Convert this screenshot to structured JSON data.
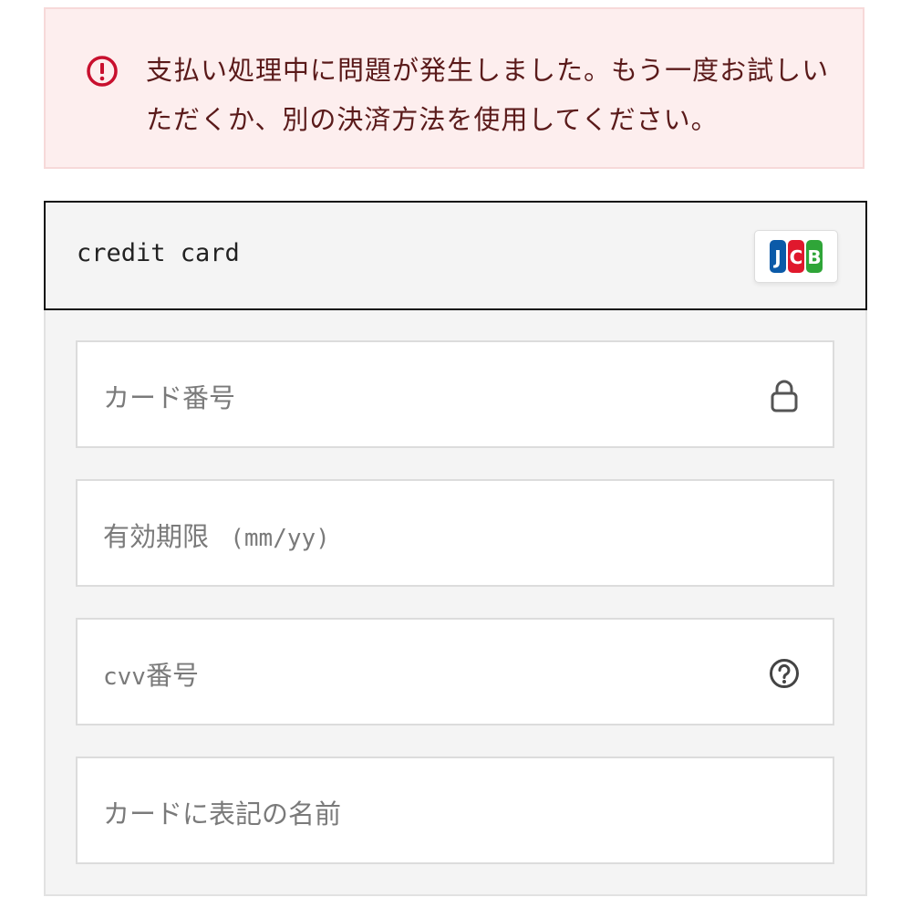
{
  "error": {
    "icon": "exclamation-circle-icon",
    "message": "支払い処理中に問題が発生しました。もう一度お試しいただくか、別の決済方法を使用してください。",
    "color": "#c8102e"
  },
  "payment_method": {
    "title": "credit card",
    "brand": "JCB"
  },
  "fields": {
    "card_number": {
      "placeholder": "カード番号",
      "icon": "lock-icon"
    },
    "expiry": {
      "placeholder": "有効期限",
      "format_hint": "(mm/yy)"
    },
    "cvv": {
      "placeholder_prefix": "cvv",
      "placeholder_suffix": "番号",
      "icon": "question-circle-icon"
    },
    "cardholder_name": {
      "placeholder": "カードに表記の名前"
    }
  }
}
